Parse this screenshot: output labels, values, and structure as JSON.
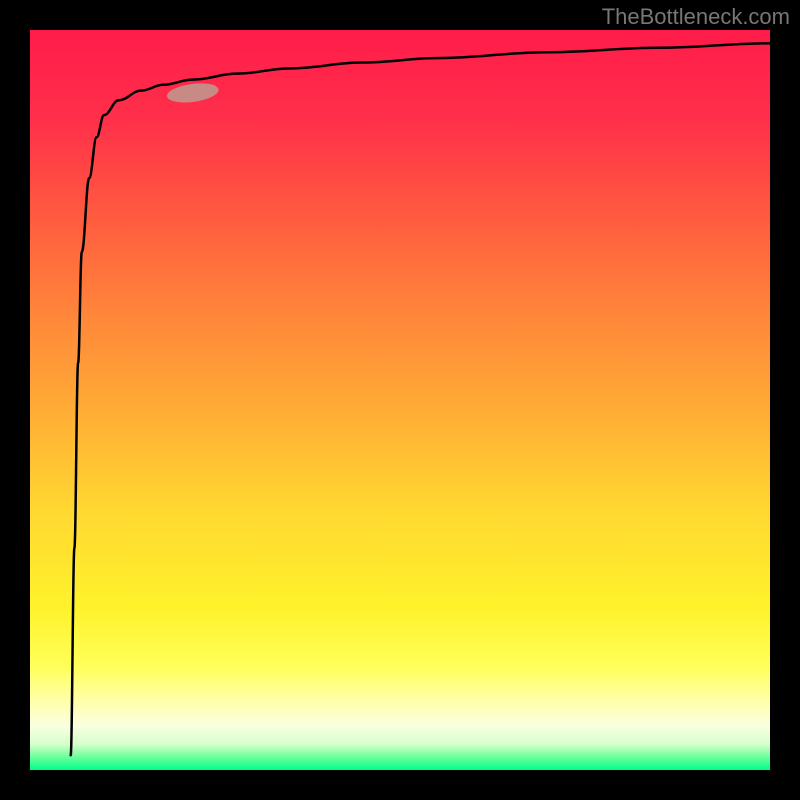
{
  "watermark": "TheBottleneck.com",
  "gradient_colors": {
    "top": "#ff1c4a",
    "mid_upper": "#ff843a",
    "mid": "#ffd830",
    "mid_lower": "#ffff5a",
    "bottom": "#00ff88"
  },
  "marker": {
    "color": "#c78a84",
    "rx_fraction": 0.22,
    "ry_fraction": 0.085
  },
  "chart_data": {
    "type": "line",
    "title": "",
    "xlabel": "",
    "ylabel": "",
    "xlim": [
      0,
      1
    ],
    "ylim": [
      0,
      1
    ],
    "x": [
      0.055,
      0.06,
      0.065,
      0.07,
      0.08,
      0.09,
      0.1,
      0.12,
      0.15,
      0.18,
      0.22,
      0.28,
      0.35,
      0.45,
      0.55,
      0.7,
      0.85,
      1.0
    ],
    "values": [
      0.02,
      0.3,
      0.55,
      0.7,
      0.8,
      0.855,
      0.885,
      0.905,
      0.918,
      0.926,
      0.933,
      0.941,
      0.948,
      0.956,
      0.962,
      0.97,
      0.976,
      0.982
    ],
    "series": [
      {
        "name": "curve",
        "type": "line"
      }
    ],
    "marker_point": {
      "x": 0.22,
      "y": 0.915
    }
  }
}
